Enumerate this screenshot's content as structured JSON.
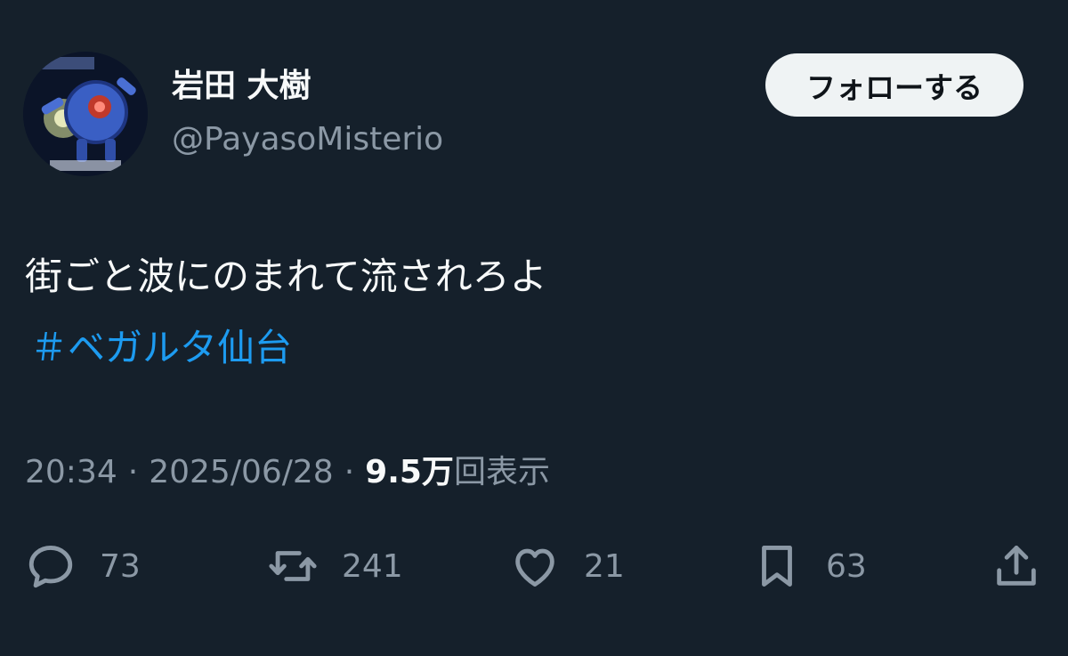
{
  "author": {
    "display_name": "岩田 大樹",
    "handle": "@PayasoMisterio"
  },
  "follow_button": {
    "label": "フォローする"
  },
  "tweet": {
    "text": "街ごと波にのまれて流されろよ",
    "hashtag": "＃ベガルタ仙台"
  },
  "meta": {
    "time": "20:34",
    "separator": "·",
    "date": "2025/06/28",
    "views_count": "9.5万",
    "views_label": "回表示"
  },
  "actions": {
    "reply": {
      "icon": "reply-icon",
      "count": "73"
    },
    "retweet": {
      "icon": "retweet-icon",
      "count": "241"
    },
    "like": {
      "icon": "heart-icon",
      "count": "21"
    },
    "bookmark": {
      "icon": "bookmark-icon",
      "count": "63"
    },
    "share": {
      "icon": "share-icon"
    }
  },
  "colors": {
    "background": "#15202b",
    "text_primary": "#f7f9f9",
    "text_secondary": "#8b98a5",
    "link": "#1d9bf0",
    "button_bg": "#eff3f4"
  }
}
